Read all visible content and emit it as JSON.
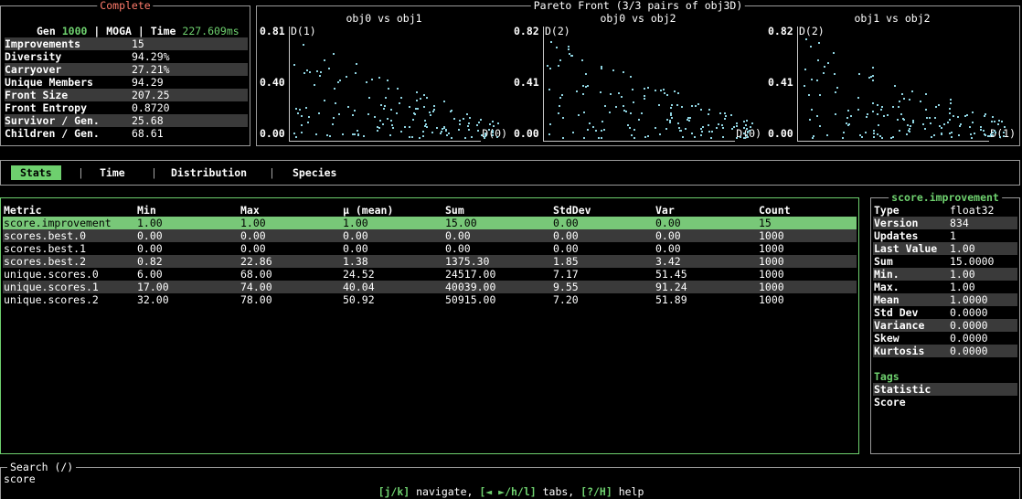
{
  "status": {
    "title": "Complete",
    "gen_label": "Gen",
    "gen": "1000",
    "sep": "|",
    "algo": "MOGA",
    "time_label": "Time",
    "time": "227.609ms",
    "metrics": [
      {
        "label": "Improvements",
        "value": "15"
      },
      {
        "label": "Diversity",
        "value": "94.29%"
      },
      {
        "label": "Carryover",
        "value": "27.21%"
      },
      {
        "label": "Unique Members",
        "value": "94.29"
      },
      {
        "label": "Front Size",
        "value": "207.25"
      },
      {
        "label": "Front Entropy",
        "value": "0.8720"
      },
      {
        "label": "Survivor / Gen.",
        "value": "25.68"
      },
      {
        "label": "Children / Gen.",
        "value": "68.61"
      }
    ]
  },
  "pareto": {
    "title": "Pareto Front (3/3 pairs of obj3D)",
    "plots": [
      {
        "title": "obj0 vs obj1",
        "ymax": "0.81",
        "ymid": "0.40",
        "ymin": "0.00",
        "ylabel": "D(1)",
        "xlabel": "D(0)"
      },
      {
        "title": "obj0 vs obj2",
        "ymax": "0.82",
        "ymid": "0.41",
        "ymin": "0.00",
        "ylabel": "D(2)",
        "xlabel": "D(0)"
      },
      {
        "title": "obj1 vs obj2",
        "ymax": "0.82",
        "ymid": "0.41",
        "ymin": "0.00",
        "ylabel": "D(2)",
        "xlabel": "D(1)"
      }
    ],
    "point_color": "#8fd3e0"
  },
  "tabs": {
    "items": [
      "Stats",
      "Time",
      "Distribution",
      "Species"
    ],
    "active": 0,
    "accent": "#6ed06e"
  },
  "table": {
    "headers": [
      "Metric",
      "Min",
      "Max",
      "μ (mean)",
      "Sum",
      "StdDev",
      "Var",
      "Count"
    ],
    "rows": [
      [
        "score.improvement",
        "1.00",
        "1.00",
        "1.00",
        "15.00",
        "0.00",
        "0.00",
        "15"
      ],
      [
        "scores.best.0",
        "0.00",
        "0.00",
        "0.00",
        "0.00",
        "0.00",
        "0.00",
        "1000"
      ],
      [
        "scores.best.1",
        "0.00",
        "0.00",
        "0.00",
        "0.00",
        "0.00",
        "0.00",
        "1000"
      ],
      [
        "scores.best.2",
        "0.82",
        "22.86",
        "1.38",
        "1375.30",
        "1.85",
        "3.42",
        "1000"
      ],
      [
        "unique.scores.0",
        "6.00",
        "68.00",
        "24.52",
        "24517.00",
        "7.17",
        "51.45",
        "1000"
      ],
      [
        "unique.scores.1",
        "17.00",
        "74.00",
        "40.04",
        "40039.00",
        "9.55",
        "91.24",
        "1000"
      ],
      [
        "unique.scores.2",
        "32.00",
        "78.00",
        "50.92",
        "50915.00",
        "7.20",
        "51.89",
        "1000"
      ]
    ],
    "selected": 0
  },
  "detail": {
    "title": "score.improvement",
    "rows": [
      {
        "label": "Type",
        "value": "float32"
      },
      {
        "label": "Version",
        "value": "834"
      },
      {
        "label": "Updates",
        "value": "1"
      },
      {
        "label": "Last Value",
        "value": "1.00"
      },
      {
        "label": "Sum",
        "value": "15.0000"
      },
      {
        "label": "Min.",
        "value": "1.00"
      },
      {
        "label": "Max.",
        "value": "1.00"
      },
      {
        "label": "Mean",
        "value": "1.0000"
      },
      {
        "label": "Std Dev",
        "value": "0.0000"
      },
      {
        "label": "Variance",
        "value": "0.0000"
      },
      {
        "label": "Skew",
        "value": "0.0000"
      },
      {
        "label": "Kurtosis",
        "value": "0.0000"
      }
    ],
    "tags_title": "Tags",
    "tags": [
      "Statistic",
      "Score"
    ]
  },
  "search": {
    "title": "Search (/)",
    "value": "score"
  },
  "footer": {
    "k1": "[j/k]",
    "t1": " navigate, ",
    "k2": "[◄ ►/h/l]",
    "t2": " tabs, ",
    "k3": "[?/H]",
    "t3": " help"
  }
}
